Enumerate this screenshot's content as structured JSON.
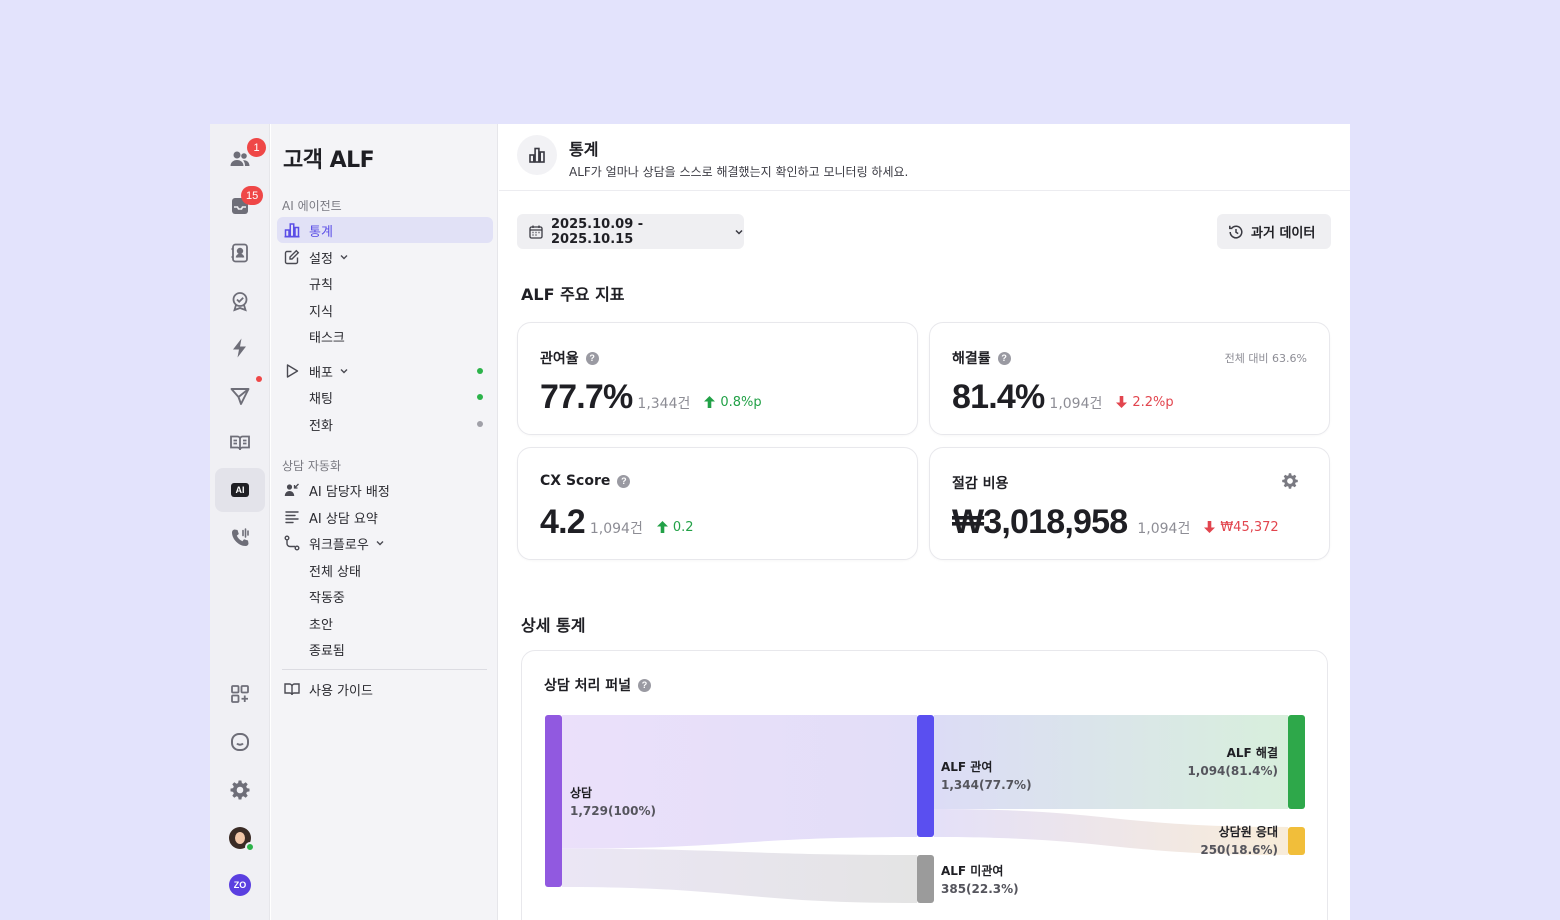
{
  "rail": {
    "badges": {
      "people": "1",
      "inbox": "15"
    },
    "ai_label": "AI",
    "zo_label": "ZO"
  },
  "sidebar": {
    "title": "고객 ALF",
    "section_ai_agent": "AI 에이전트",
    "items": {
      "stats": "통계",
      "settings": "설정",
      "rules": "규칙",
      "knowledge": "지식",
      "tasks": "태스크",
      "deploy": "배포",
      "chatting": "채팅",
      "phone": "전화"
    },
    "section_automation": "상담 자동화",
    "automation": {
      "assign": "AI 담당자 배정",
      "summary": "AI 상담 요약",
      "workflow": "워크플로우",
      "all_status": "전체 상태",
      "running": "작동중",
      "draft": "초안",
      "ended": "종료됨"
    },
    "guide": "사용 가이드",
    "status_colors": {
      "active": "#2cb34a",
      "inactive": "#a0a0a8"
    }
  },
  "header": {
    "title": "통계",
    "subtitle": "ALF가 얼마나 상담을 스스로 해결했는지 확인하고 모니터링 하세요."
  },
  "toolbar": {
    "date_range": "2025.10.09 - 2025.10.15",
    "history_button": "과거 데이터"
  },
  "metrics_section_title": "ALF 주요 지표",
  "metrics": {
    "involvement": {
      "label": "관여율",
      "value": "77.7%",
      "count": "1,344건",
      "delta": "0.8%p",
      "direction": "up"
    },
    "resolution": {
      "label": "해결률",
      "value": "81.4%",
      "count": "1,094건",
      "delta": "2.2%p",
      "direction": "down",
      "note": "전체 대비 63.6%"
    },
    "cx_score": {
      "label": "CX Score",
      "value": "4.2",
      "count": "1,094건",
      "delta": "0.2",
      "direction": "up"
    },
    "savings": {
      "label": "절감 비용",
      "value": "₩3,018,958",
      "count": "1,094건",
      "delta": "₩45,372",
      "direction": "down"
    }
  },
  "detail_section_title": "상세 통계",
  "funnel": {
    "title": "상담 처리 퍼널",
    "nodes": {
      "total": {
        "name": "상담",
        "value": "1,729(100%)",
        "count": 1729,
        "color": "#9159e0"
      },
      "alf_involved": {
        "name": "ALF 관여",
        "value": "1,344(77.7%)",
        "count": 1344,
        "color": "#5a4ff0"
      },
      "alf_not_involved": {
        "name": "ALF 미관여",
        "value": "385(22.3%)",
        "count": 385,
        "color": "#9b9b9b"
      },
      "alf_resolved": {
        "name": "ALF 해결",
        "value": "1,094(81.4%)",
        "count": 1094,
        "color": "#2ea84a"
      },
      "agent_handled": {
        "name": "상담원 응대",
        "value": "250(18.6%)",
        "count": 250,
        "color": "#f1be3a"
      }
    }
  }
}
